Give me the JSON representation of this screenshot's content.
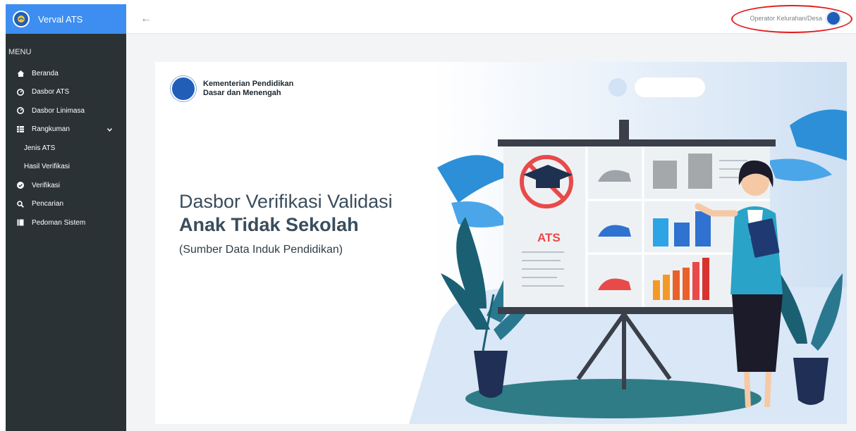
{
  "brand": {
    "name": "Verval ATS"
  },
  "menu": {
    "heading": "MENU",
    "items": [
      {
        "label": "Beranda",
        "icon": "home-icon"
      },
      {
        "label": "Dasbor ATS",
        "icon": "gauge-icon"
      },
      {
        "label": "Dasbor Linimasa",
        "icon": "gauge-icon"
      },
      {
        "label": "Rangkuman",
        "icon": "table-icon"
      },
      {
        "label": "Verifikasi",
        "icon": "check-circle-icon"
      },
      {
        "label": "Pencarian",
        "icon": "search-icon"
      },
      {
        "label": "Pedoman Sistem",
        "icon": "book-icon"
      }
    ],
    "submenu": [
      {
        "label": "Jenis ATS"
      },
      {
        "label": "Hasil Verifikasi"
      }
    ]
  },
  "topbar": {
    "user_label": "Operator Kelurahan/Desa",
    "back_icon": "arrow-left-icon"
  },
  "banner": {
    "ministry_line1": "Kementerian Pendidikan",
    "ministry_line2": "Dasar dan Menengah",
    "title_line1": "Dasbor Verifikasi Validasi",
    "title_line2": "Anak Tidak Sekolah",
    "subtitle": "(Sumber Data Induk Pendidikan)",
    "board_label": "ATS"
  },
  "colors": {
    "sidebar": "#2b3236",
    "brand": "#3d8ef0",
    "accent_red": "#e31c1c",
    "content_bg": "#f2f4f5"
  }
}
